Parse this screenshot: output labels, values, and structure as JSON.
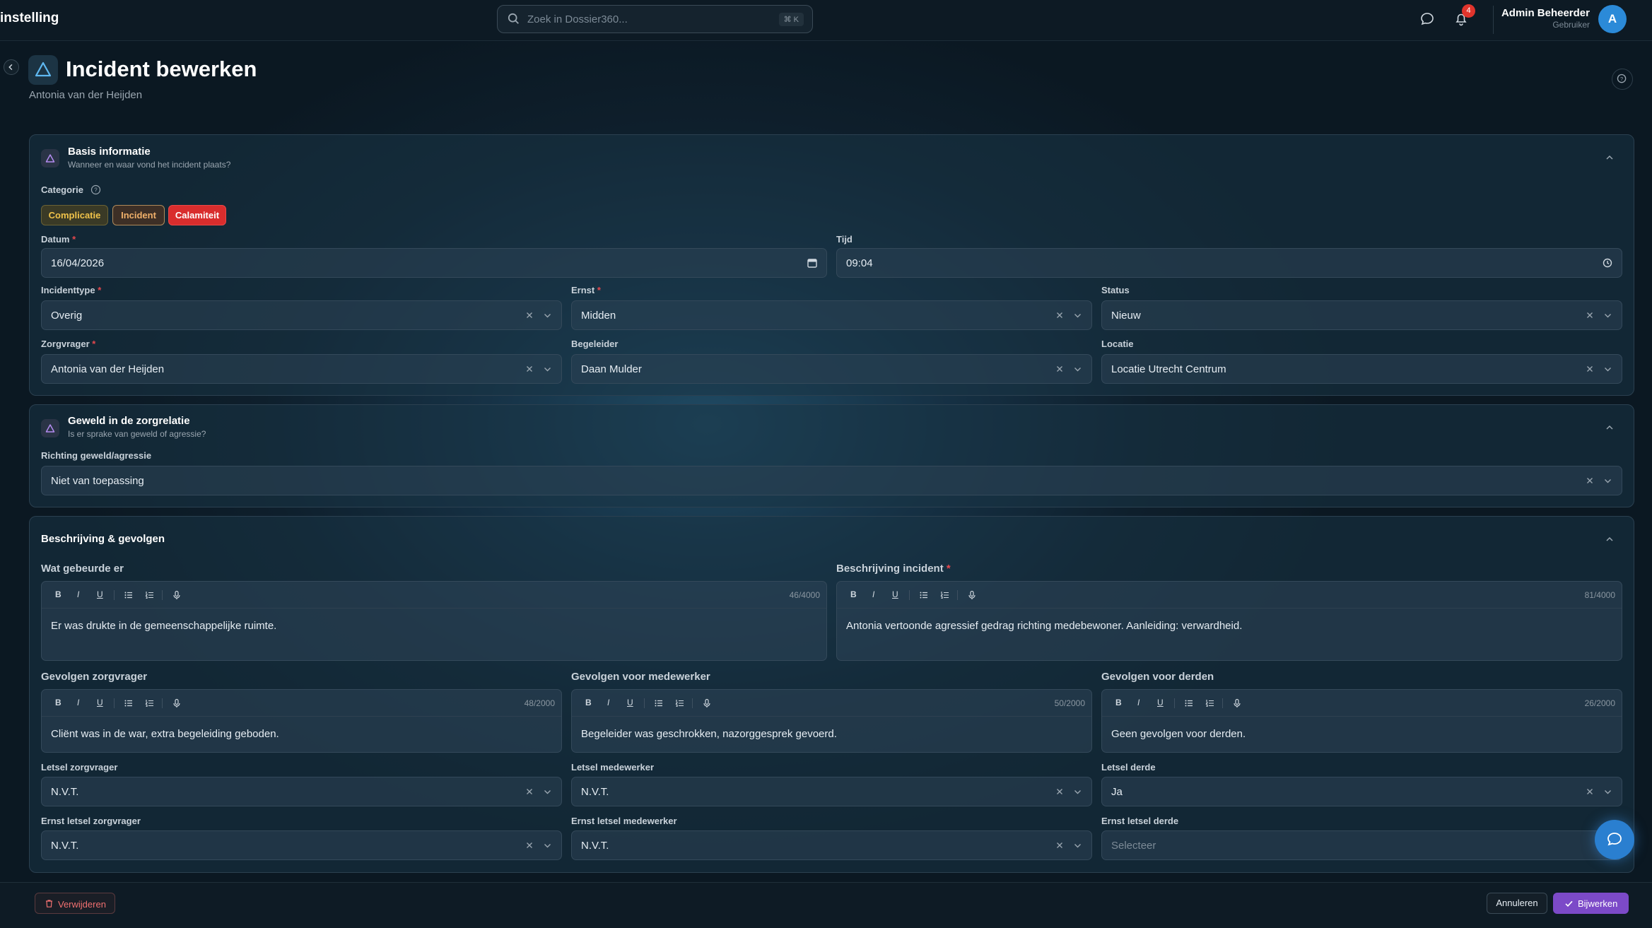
{
  "topbar": {
    "brand": "instelling",
    "search_placeholder": "Zoek in Dossier360...",
    "search_shortcut": "⌘ K",
    "notification_count": "4",
    "user_name": "Admin Beheerder",
    "user_role": "Gebruiker",
    "avatar_initial": "A"
  },
  "header": {
    "title": "Incident bewerken",
    "subtitle": "Antonia van der Heijden"
  },
  "basis": {
    "title": "Basis informatie",
    "subtitle": "Wanneer en waar vond het incident plaats?",
    "categorie_label": "Categorie",
    "chips": [
      "Complicatie",
      "Incident",
      "Calamiteit"
    ],
    "datum_label": "Datum",
    "datum_value": "16/04/2026",
    "tijd_label": "Tijd",
    "tijd_value": "09:04",
    "incidenttype_label": "Incidenttype",
    "incidenttype_value": "Overig",
    "ernst_label": "Ernst",
    "ernst_value": "Midden",
    "status_label": "Status",
    "status_value": "Nieuw",
    "zorgvrager_label": "Zorgvrager",
    "zorgvrager_value": "Antonia van der Heijden",
    "begeleider_label": "Begeleider",
    "begeleider_value": "Daan Mulder",
    "locatie_label": "Locatie",
    "locatie_value": "Locatie Utrecht Centrum"
  },
  "geweld": {
    "title": "Geweld in de zorgrelatie",
    "subtitle": "Is er sprake van geweld of agressie?",
    "richting_label": "Richting geweld/agressie",
    "richting_value": "Niet van toepassing"
  },
  "beschrijving": {
    "title": "Beschrijving & gevolgen",
    "tools": {
      "bold": "B",
      "italic": "I",
      "underline": "U"
    },
    "wat_label": "Wat gebeurde er",
    "wat_count": "46/4000",
    "wat_text": "Er was drukte in de gemeenschappelijke ruimte.",
    "incident_label": "Beschrijving incident",
    "incident_count": "81/4000",
    "incident_text": "Antonia vertoonde agressief gedrag richting medebewoner. Aanleiding: verwardheid.",
    "gz_label": "Gevolgen zorgvrager",
    "gz_count": "48/2000",
    "gz_text": "Cliënt was in de war, extra begeleiding geboden.",
    "gm_label": "Gevolgen voor medewerker",
    "gm_count": "50/2000",
    "gm_text": "Begeleider was geschrokken, nazorggesprek gevoerd.",
    "gd_label": "Gevolgen voor derden",
    "gd_count": "26/2000",
    "gd_text": "Geen gevolgen voor derden.",
    "lz_label": "Letsel zorgvrager",
    "lz_value": "N.V.T.",
    "lm_label": "Letsel medewerker",
    "lm_value": "N.V.T.",
    "ld_label": "Letsel derde",
    "ld_value": "Ja",
    "elz_label": "Ernst letsel zorgvrager",
    "elz_value": "N.V.T.",
    "elm_label": "Ernst letsel medewerker",
    "elm_value": "N.V.T.",
    "eld_label": "Ernst letsel derde",
    "eld_placeholder": "Selecteer"
  },
  "footer": {
    "delete_label": "Verwijderen",
    "cancel_label": "Annuleren",
    "save_label": "Bijwerken"
  }
}
